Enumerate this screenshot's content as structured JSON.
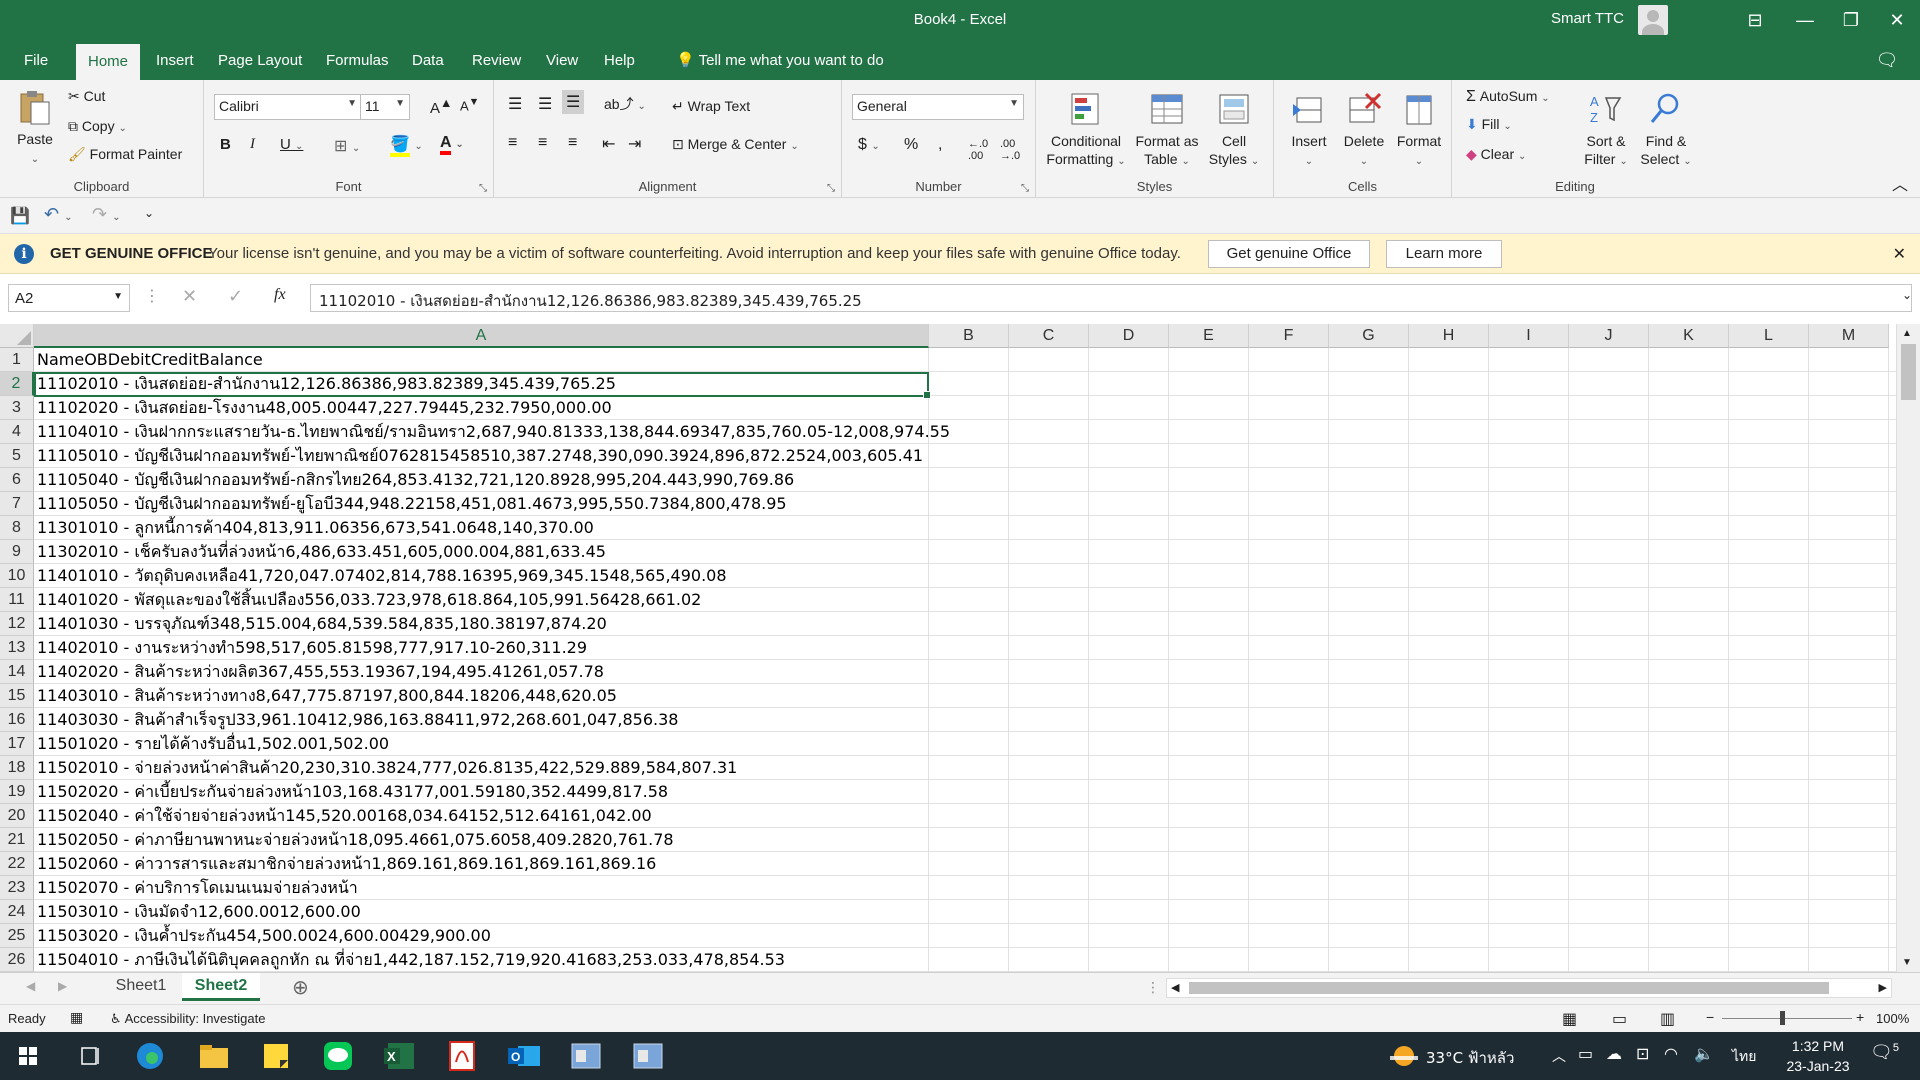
{
  "window": {
    "title": "Book4  -  Excel",
    "user": "Smart TTC"
  },
  "menu": {
    "tabs": [
      "File",
      "Home",
      "Insert",
      "Page Layout",
      "Formulas",
      "Data",
      "Review",
      "View",
      "Help"
    ],
    "active": "Home",
    "tell_me": "Tell me what you want to do"
  },
  "ribbon": {
    "clipboard": {
      "paste": "Paste",
      "cut": "Cut",
      "copy": "Copy",
      "format_painter": "Format Painter",
      "label": "Clipboard"
    },
    "font": {
      "name": "Calibri",
      "size": "11",
      "label": "Font"
    },
    "alignment": {
      "wrap_text": "Wrap Text",
      "merge_center": "Merge & Center",
      "label": "Alignment"
    },
    "number": {
      "format": "General",
      "label": "Number"
    },
    "styles": {
      "conditional": [
        "Conditional",
        "Formatting"
      ],
      "format_table": [
        "Format as",
        "Table"
      ],
      "cell_styles": [
        "Cell",
        "Styles"
      ],
      "label": "Styles"
    },
    "cells": {
      "insert": "Insert",
      "delete": "Delete",
      "format": "Format",
      "label": "Cells"
    },
    "editing": {
      "autosum": "AutoSum",
      "fill": "Fill",
      "clear": "Clear",
      "sort_filter": [
        "Sort &",
        "Filter"
      ],
      "find_select": [
        "Find &",
        "Select"
      ],
      "label": "Editing"
    }
  },
  "warning": {
    "title": "GET GENUINE OFFICE",
    "message": "Your license isn't genuine, and you may be a victim of software counterfeiting. Avoid interruption and keep your files safe with genuine Office today.",
    "btn_genuine": "Get genuine Office",
    "btn_learn": "Learn more"
  },
  "formula_bar": {
    "name_box": "A2",
    "formula": "11102010 - เงินสดย่อย-สำนักงาน12,126.86386,983.82389,345.439,765.25"
  },
  "grid": {
    "columns": [
      "A",
      "B",
      "C",
      "D",
      "E",
      "F",
      "G",
      "H",
      "I",
      "J",
      "K",
      "L",
      "M"
    ],
    "selected_column": "A",
    "selected_row": 2,
    "rows": [
      {
        "n": "1",
        "a": "NameOBDebitCreditBalance"
      },
      {
        "n": "2",
        "a": "11102010 - เงินสดย่อย-สำนักงาน12,126.86386,983.82389,345.439,765.25"
      },
      {
        "n": "3",
        "a": "11102020 - เงินสดย่อย-โรงงาน48,005.00447,227.79445,232.7950,000.00"
      },
      {
        "n": "4",
        "a": "11104010 - เงินฝากกระแสรายวัน-ธ.ไทยพาณิชย์/รามอินทรา2,687,940.81333,138,844.69347,835,760.05-12,008,974.55"
      },
      {
        "n": "5",
        "a": "11105010 - บัญชีเงินฝากออมทรัพย์-ไทยพาณิชย์0762815458510,387.2748,390,090.3924,896,872.2524,003,605.41"
      },
      {
        "n": "6",
        "a": "11105040 - บัญชีเงินฝากออมทรัพย์-กสิกรไทย264,853.4132,721,120.8928,995,204.443,990,769.86"
      },
      {
        "n": "7",
        "a": "11105050 - บัญชีเงินฝากออมทรัพย์-ยูโอบี344,948.22158,451,081.4673,995,550.7384,800,478.95"
      },
      {
        "n": "8",
        "a": "11301010 - ลูกหนี้การค้า404,813,911.06356,673,541.0648,140,370.00"
      },
      {
        "n": "9",
        "a": "11302010 - เช็ครับลงวันที่ล่วงหน้า6,486,633.451,605,000.004,881,633.45"
      },
      {
        "n": "10",
        "a": "11401010 - วัตถุดิบคงเหลือ41,720,047.07402,814,788.16395,969,345.1548,565,490.08"
      },
      {
        "n": "11",
        "a": "11401020 - พัสดุและของใช้สิ้นเปลือง556,033.723,978,618.864,105,991.56428,661.02"
      },
      {
        "n": "12",
        "a": "11401030 - บรรจุภัณฑ์348,515.004,684,539.584,835,180.38197,874.20"
      },
      {
        "n": "13",
        "a": "11402010 - งานระหว่างทำ598,517,605.81598,777,917.10-260,311.29"
      },
      {
        "n": "14",
        "a": "11402020 - สินค้าระหว่างผลิต367,455,553.19367,194,495.41261,057.78"
      },
      {
        "n": "15",
        "a": "11403010 - สินค้าระหว่างทาง8,647,775.87197,800,844.18206,448,620.05"
      },
      {
        "n": "16",
        "a": "11403030 - สินค้าสำเร็จรูป33,961.10412,986,163.88411,972,268.601,047,856.38"
      },
      {
        "n": "17",
        "a": "11501020 - รายได้ค้างรับอื่น1,502.001,502.00"
      },
      {
        "n": "18",
        "a": "11502010 - จ่ายล่วงหน้าค่าสินค้า20,230,310.3824,777,026.8135,422,529.889,584,807.31"
      },
      {
        "n": "19",
        "a": "11502020 - ค่าเบี้ยประกันจ่ายล่วงหน้า103,168.43177,001.59180,352.4499,817.58"
      },
      {
        "n": "20",
        "a": "11502040 - ค่าใช้จ่ายจ่ายล่วงหน้า145,520.00168,034.64152,512.64161,042.00"
      },
      {
        "n": "21",
        "a": "11502050 - ค่าภาษียานพาหนะจ่ายล่วงหน้า18,095.4661,075.6058,409.2820,761.78"
      },
      {
        "n": "22",
        "a": "11502060 - ค่าวารสารและสมาชิกจ่ายล่วงหน้า1,869.161,869.161,869.161,869.16"
      },
      {
        "n": "23",
        "a": "11502070 - ค่าบริการโดเมนเนมจ่ายล่วงหน้า"
      },
      {
        "n": "24",
        "a": "11503010 - เงินมัดจำ12,600.0012,600.00"
      },
      {
        "n": "25",
        "a": "11503020 - เงินค้ำประกัน454,500.0024,600.00429,900.00"
      },
      {
        "n": "26",
        "a": "11504010 - ภาษีเงินได้นิติบุคคลถูกหัก ณ ที่จ่าย1,442,187.152,719,920.41683,253.033,478,854.53"
      }
    ]
  },
  "sheets": {
    "tabs": [
      "Sheet1",
      "Sheet2"
    ],
    "active": "Sheet2"
  },
  "status": {
    "mode": "Ready",
    "accessibility": "Accessibility: Investigate",
    "zoom": "100%"
  },
  "taskbar": {
    "weather": "33°C ฟ้าหลัว",
    "lang": "ไทย",
    "time": "1:32 PM",
    "date": "23-Jan-23",
    "notif": "5"
  },
  "colors": {
    "excel_green": "#217346",
    "warning_bg": "#fff4ce",
    "taskbar": "#1f2b33"
  }
}
